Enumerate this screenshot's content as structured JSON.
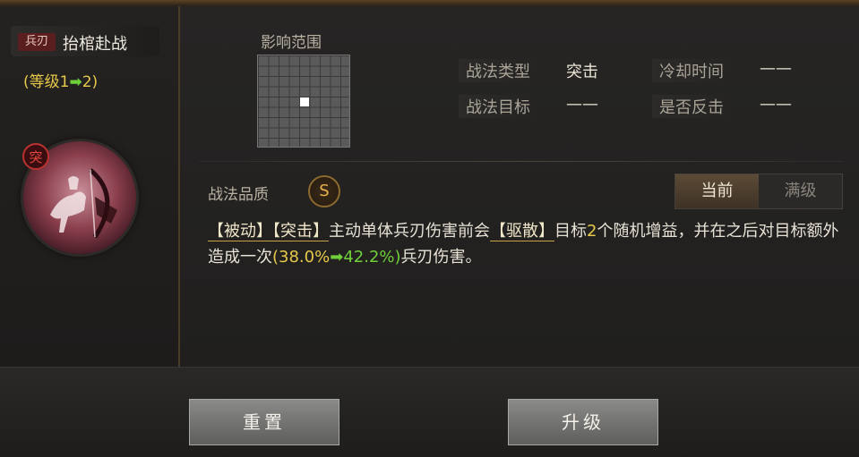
{
  "skill": {
    "type_tag": "兵刃",
    "name": "抬棺赴战",
    "level_prefix": "(等级1",
    "level_arrow": "➡",
    "level_suffix": "2)",
    "assault_badge": "突"
  },
  "range": {
    "title": "影响范围"
  },
  "info": {
    "type_label": "战法类型",
    "type_value": "突击",
    "cooldown_label": "冷却时间",
    "cooldown_value": "——",
    "target_label": "战法目标",
    "target_value": "——",
    "counter_label": "是否反击",
    "counter_value": "——"
  },
  "quality": {
    "label": "战法品质",
    "grade": "S"
  },
  "toggle": {
    "current": "当前",
    "max": "满级"
  },
  "description": {
    "t1": "【被动】",
    "t2": "【突击】",
    "t3": "主动单体兵刃伤害前会",
    "t4": "【驱散】",
    "t5": "目标",
    "t6": "2",
    "t7": "个随机增益，并在之后对目标额外造成一次",
    "t8": "(38.0%",
    "t9": "➡",
    "t10": "42.2%)",
    "t11": "兵刃伤害。"
  },
  "buttons": {
    "reset": "重置",
    "upgrade": "升级"
  },
  "colors": {
    "accent_gold": "#e6c84a",
    "accent_green": "#6fce3a",
    "assault_red": "#b8322f"
  }
}
